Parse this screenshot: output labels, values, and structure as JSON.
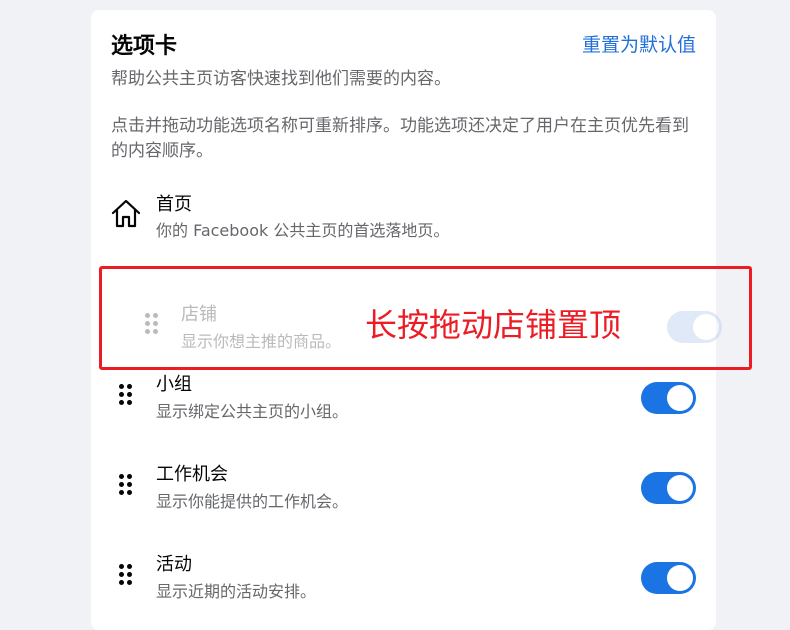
{
  "panel": {
    "title": "选项卡",
    "reset_label": "重置为默认值",
    "description": "帮助公共主页访客快速找到他们需要的内容。",
    "instructions": "点击并拖动功能选项名称可重新排序。功能选项还决定了用户在主页优先看到的内容顺序。"
  },
  "home": {
    "title": "首页",
    "subtitle": "你的 Facebook 公共主页的首选落地页。",
    "icon": "home-icon"
  },
  "dragging": {
    "title": "店铺",
    "subtitle": "显示你想主推的商品。",
    "enabled": true
  },
  "annotation": "长按拖动店铺置顶",
  "tabs": [
    {
      "title": "小组",
      "subtitle": "显示绑定公共主页的小组。",
      "enabled": true
    },
    {
      "title": "工作机会",
      "subtitle": "显示你能提供的工作机会。",
      "enabled": true
    },
    {
      "title": "活动",
      "subtitle": "显示近期的活动安排。",
      "enabled": true
    }
  ],
  "colors": {
    "accent": "#1b74e4",
    "link": "#216fdb",
    "annotation": "#ec1c24"
  }
}
